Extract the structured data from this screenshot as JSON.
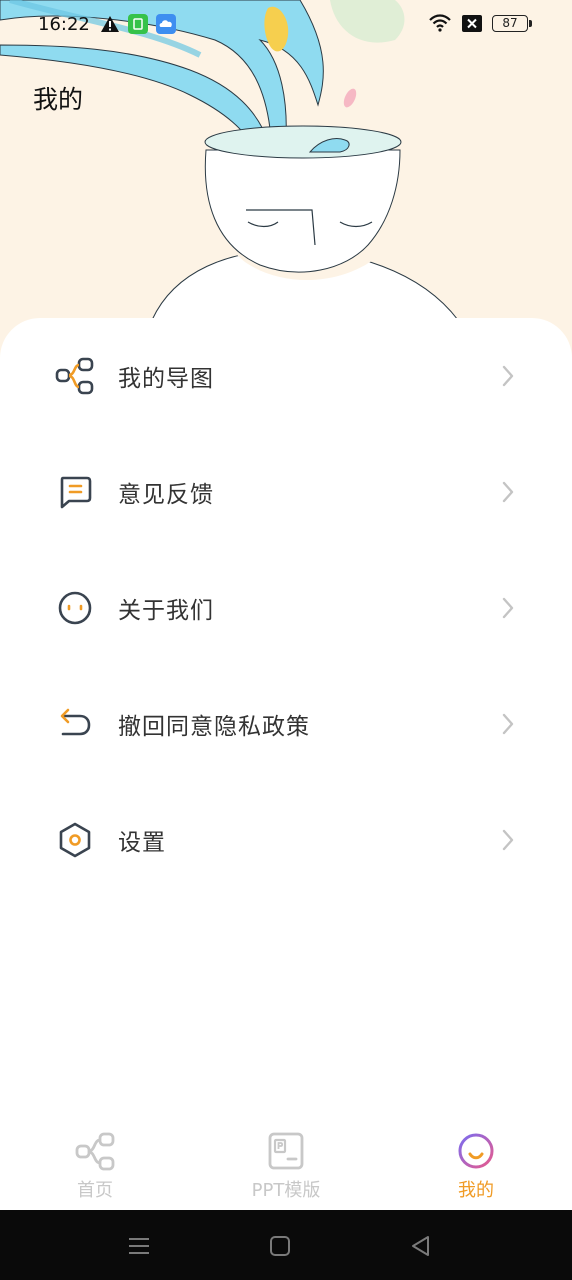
{
  "status_bar": {
    "time": "16:22",
    "battery": "87",
    "icons": [
      "alert-icon",
      "app-notification-icon",
      "cloud-app-icon",
      "wifi-icon",
      "no-sim-icon",
      "battery-icon"
    ]
  },
  "page": {
    "title": "我的"
  },
  "menu": {
    "items": [
      {
        "label": "我的导图",
        "icon": "mindmap-icon"
      },
      {
        "label": "意见反馈",
        "icon": "feedback-icon"
      },
      {
        "label": "关于我们",
        "icon": "about-icon"
      },
      {
        "label": "撤回同意隐私政策",
        "icon": "undo-icon"
      },
      {
        "label": "设置",
        "icon": "settings-icon"
      }
    ]
  },
  "bottom_nav": {
    "items": [
      {
        "label": "首页",
        "icon": "home-mindmap-icon",
        "active": false
      },
      {
        "label": "PPT模版",
        "icon": "ppt-icon",
        "active": false
      },
      {
        "label": "我的",
        "icon": "profile-icon",
        "active": true
      }
    ]
  },
  "colors": {
    "accent": "#f09b25",
    "header_bg": "#fdf3e5",
    "water": "#8fdbf0",
    "inactive": "#c8c8c8",
    "text": "#333333"
  }
}
